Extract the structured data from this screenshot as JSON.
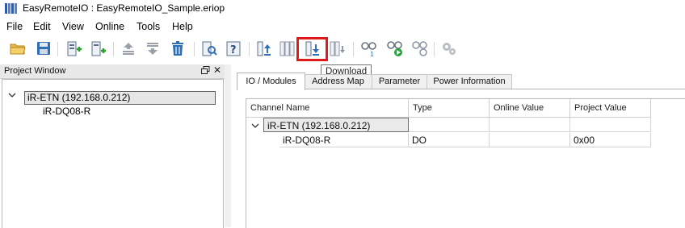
{
  "window": {
    "title": "EasyRemoteIO : EasyRemoteIO_Sample.eriop",
    "app_icon": "app-icon"
  },
  "menu": [
    "File",
    "Edit",
    "View",
    "Online",
    "Tools",
    "Help"
  ],
  "toolbar": {
    "buttons": [
      {
        "icon": "open-folder-icon"
      },
      {
        "icon": "save-icon"
      },
      {
        "icon": "add-module-icon"
      },
      {
        "icon": "add-module-alt-icon"
      },
      {
        "icon": "move-up-icon"
      },
      {
        "icon": "move-down-icon"
      },
      {
        "icon": "delete-icon"
      },
      {
        "icon": "search-device-icon"
      },
      {
        "icon": "help-device-icon"
      },
      {
        "icon": "upload-icon"
      },
      {
        "icon": "upload-all-icon"
      },
      {
        "icon": "download-icon"
      },
      {
        "icon": "download-all-icon"
      },
      {
        "icon": "connect-icon"
      },
      {
        "icon": "monitor-start-icon"
      },
      {
        "icon": "disconnect-icon"
      },
      {
        "icon": "settings-icon"
      }
    ],
    "highlighted_button": "download-icon",
    "highlight_color": "#e01919",
    "tooltip": "Download"
  },
  "project_window": {
    "title": "Project Window",
    "tree": [
      {
        "label": "iR-ETN (192.168.0.212)",
        "expanded": true,
        "selected": true,
        "children": [
          {
            "label": "iR-DQ08-R"
          }
        ]
      }
    ]
  },
  "tabs": [
    {
      "label": "IO / Modules",
      "active": true
    },
    {
      "label": "Address Map",
      "active": false
    },
    {
      "label": "Parameter",
      "active": false
    },
    {
      "label": "Power Information",
      "active": false
    }
  ],
  "grid": {
    "columns": [
      "Channel Name",
      "Type",
      "Online Value",
      "Project Value"
    ],
    "rows": [
      {
        "name": "iR-ETN (192.168.0.212)",
        "type": "",
        "online": "",
        "project": "",
        "expanded": true
      },
      {
        "name": "iR-DQ08-R",
        "type": "DO",
        "online": "",
        "project": "0x00"
      }
    ]
  }
}
